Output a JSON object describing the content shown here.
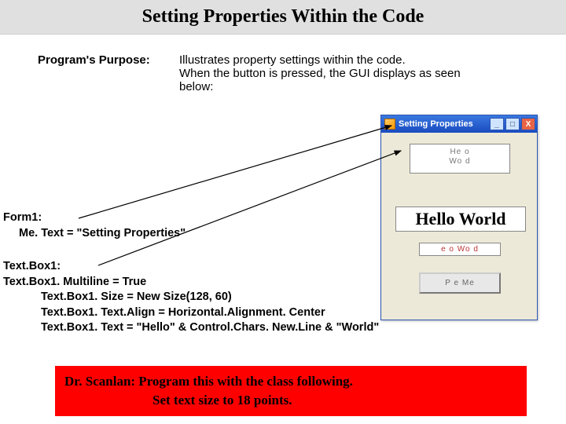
{
  "title": "Setting Properties Within the Code",
  "purpose": {
    "label": "Program's Purpose:",
    "text_l1": "Illustrates property settings within the code.",
    "text_l2": "When the button is pressed, the GUI displays as seen",
    "text_l3": "below:"
  },
  "form_block": {
    "head": "Form1:",
    "line1": "Me. Text = \"Setting Properties\""
  },
  "tb_block": {
    "head": "Text.Box1:",
    "l1": "Text.Box1. Multiline = True",
    "l2": "Text.Box1. Size = New Size(128, 60)",
    "l3": "Text.Box1. Text.Align = Horizontal.Alignment. Center",
    "l4": "Text.Box1. Text = \"Hello\" & Control.Chars. New.Line & \"World\""
  },
  "red": {
    "l1": "Dr. Scanlan: Program  this with the class following.",
    "l2": "Set text size  to 18 points."
  },
  "mock": {
    "title": "Setting Properties",
    "multi_l1": "He  o",
    "multi_l2": "Wo  d",
    "hello": "Hello World",
    "small": "  e  o Wo  d",
    "button": "P  e     Me",
    "min": "_",
    "max": "□",
    "close": "X"
  }
}
